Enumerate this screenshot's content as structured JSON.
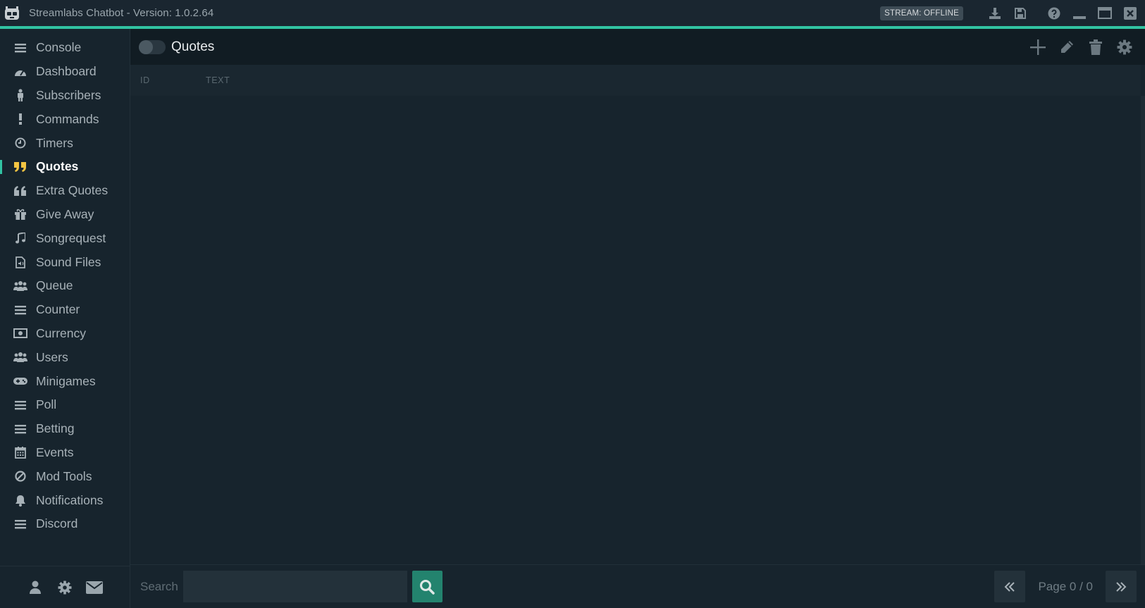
{
  "window": {
    "title": "Streamlabs Chatbot - Version: 1.0.2.64",
    "stream_status": "STREAM: OFFLINE",
    "accent_color": "#31c3a2"
  },
  "sidebar": {
    "items": [
      {
        "label": "Console",
        "icon": "list-icon"
      },
      {
        "label": "Dashboard",
        "icon": "dashboard-icon"
      },
      {
        "label": "Subscribers",
        "icon": "person-icon"
      },
      {
        "label": "Commands",
        "icon": "exclamation-icon"
      },
      {
        "label": "Timers",
        "icon": "clock-icon"
      },
      {
        "label": "Quotes",
        "icon": "quote-right-icon",
        "active": true
      },
      {
        "label": "Extra Quotes",
        "icon": "quote-left-icon"
      },
      {
        "label": "Give Away",
        "icon": "gift-icon"
      },
      {
        "label": "Songrequest",
        "icon": "music-icon"
      },
      {
        "label": "Sound Files",
        "icon": "sound-file-icon"
      },
      {
        "label": "Queue",
        "icon": "users-icon"
      },
      {
        "label": "Counter",
        "icon": "list-icon"
      },
      {
        "label": "Currency",
        "icon": "money-icon"
      },
      {
        "label": "Users",
        "icon": "users-icon"
      },
      {
        "label": "Minigames",
        "icon": "gamepad-icon"
      },
      {
        "label": "Poll",
        "icon": "list-icon"
      },
      {
        "label": "Betting",
        "icon": "list-icon"
      },
      {
        "label": "Events",
        "icon": "calendar-icon"
      },
      {
        "label": "Mod Tools",
        "icon": "ban-icon"
      },
      {
        "label": "Notifications",
        "icon": "bell-icon"
      },
      {
        "label": "Discord",
        "icon": "list-icon"
      }
    ],
    "footer_icons": [
      "user-icon",
      "gear-icon",
      "envelope-icon"
    ]
  },
  "main": {
    "title": "Quotes",
    "enabled": false,
    "columns": [
      "ID",
      "TEXT"
    ],
    "rows": [],
    "search": {
      "label": "Search",
      "value": "",
      "placeholder": ""
    },
    "pagination": {
      "text": "Page 0 / 0"
    }
  }
}
